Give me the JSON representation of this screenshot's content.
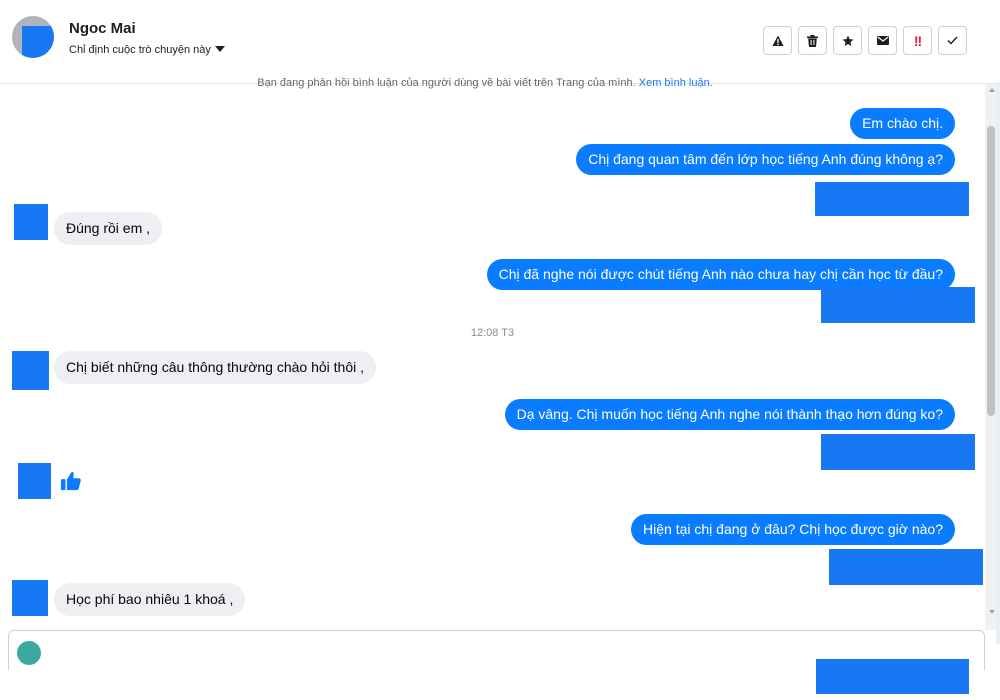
{
  "header": {
    "contact_name": "Ngoc Mai",
    "assign_label": "Chỉ định cuộc trò chuyện này"
  },
  "notice": {
    "text": "Bạn đang phản hồi bình luận của người dùng về bài viết trên Trang của mình. ",
    "link": "Xem bình luận."
  },
  "messages": {
    "m1": "Em chào chị.",
    "m2": "Chị đang quan tâm đến lớp học tiếng Anh đúng không ạ?",
    "m3": "Đúng rồi em ,",
    "m4": "Chị đã nghe nói được chút tiếng Anh nào chưa hay chị cần học từ đầu?",
    "timestamp": "12:08 T3",
    "m5": "Chị biết những câu thông thường chào hỏi thôi ,",
    "m6": "Dạ vâng. Chị muốn học tiếng Anh nghe nói thành thạo hơn đúng ko?",
    "m7": "Hiện tại chị đang ở đâu? Chị học được giờ nào?",
    "m8": "Học phí bao nhiêu 1 khoá ,"
  },
  "colors": {
    "outgoing_bubble": "#0a7cff",
    "incoming_bubble": "#eeeff2",
    "redaction": "#1877f2"
  }
}
